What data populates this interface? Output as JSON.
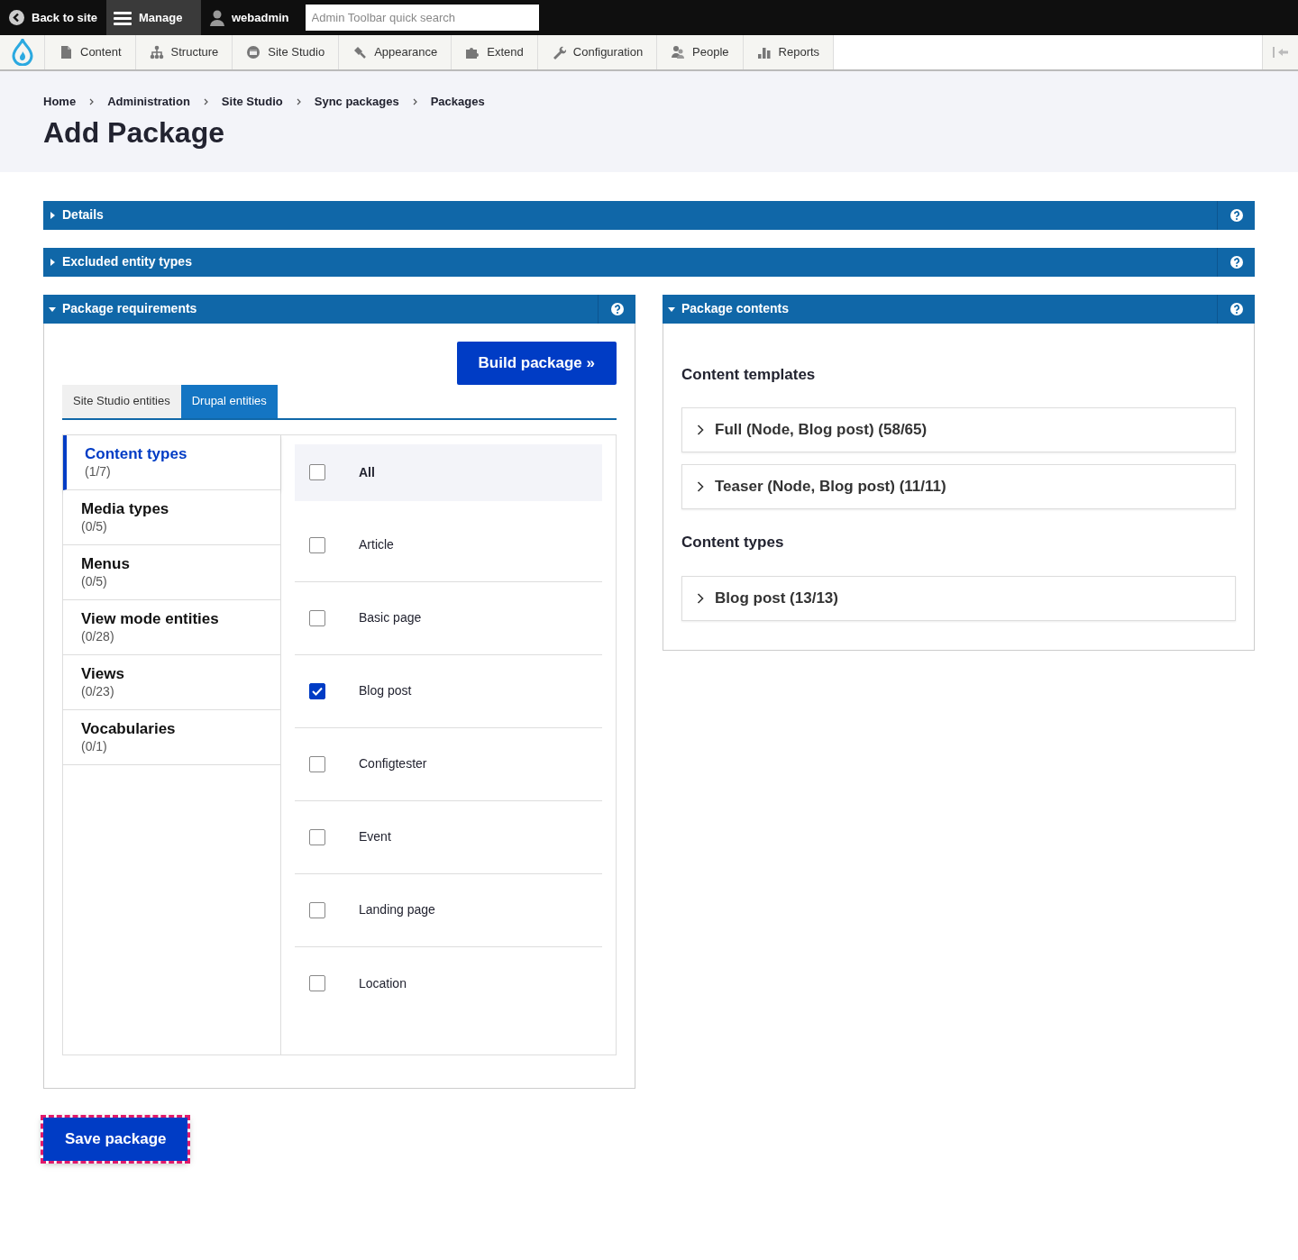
{
  "toolbar": {
    "back_link": "Back to site",
    "manage": {
      "label": "Manage",
      "selected": true
    },
    "user": "webadmin",
    "search": {
      "placeholder": "Admin Toolbar quick search"
    }
  },
  "menu": [
    {
      "label": "Content"
    },
    {
      "label": "Structure"
    },
    {
      "label": "Site Studio"
    },
    {
      "label": "Appearance"
    },
    {
      "label": "Extend"
    },
    {
      "label": "Configuration"
    },
    {
      "label": "People"
    },
    {
      "label": "Reports"
    }
  ],
  "breadcrumb": [
    "Home",
    "Administration",
    "Site Studio",
    "Sync packages",
    "Packages"
  ],
  "page_title": "Add Package",
  "sections": [
    {
      "title": "Details",
      "expanded": false
    },
    {
      "title": "Excluded entity types",
      "expanded": false
    }
  ],
  "requirements": {
    "title": "Package requirements",
    "expanded": true,
    "build_button": "Build package »",
    "tabs": [
      {
        "label": "Site Studio entities",
        "selected": false
      },
      {
        "label": "Drupal entities",
        "selected": true
      }
    ],
    "categories": [
      {
        "name": "Content types",
        "count": "(1/7)",
        "selected": true
      },
      {
        "name": "Media types",
        "count": "(0/5)",
        "selected": false
      },
      {
        "name": "Menus",
        "count": "(0/5)",
        "selected": false
      },
      {
        "name": "View mode entities",
        "count": "(0/28)",
        "selected": false
      },
      {
        "name": "Views",
        "count": "(0/23)",
        "selected": false
      },
      {
        "name": "Vocabularies",
        "count": "(0/1)",
        "selected": false
      }
    ],
    "items": [
      {
        "label": "All",
        "checked": false,
        "kind": "all"
      },
      {
        "label": "Article",
        "checked": false,
        "kind": "item"
      },
      {
        "label": "Basic page",
        "checked": false,
        "kind": "item"
      },
      {
        "label": "Blog post",
        "checked": true,
        "kind": "item"
      },
      {
        "label": "Configtester",
        "checked": false,
        "kind": "item"
      },
      {
        "label": "Event",
        "checked": false,
        "kind": "item"
      },
      {
        "label": "Landing page",
        "checked": false,
        "kind": "item"
      },
      {
        "label": "Location",
        "checked": false,
        "kind": "item"
      }
    ]
  },
  "contents": {
    "title": "Package contents",
    "expanded": true,
    "groups": [
      {
        "heading": "Content templates",
        "items": [
          "Full (Node, Blog post) (58/65)",
          "Teaser (Node, Blog post) (11/11)"
        ]
      },
      {
        "heading": "Content types",
        "items": [
          "Blog post (13/13)"
        ]
      }
    ]
  },
  "save_button": {
    "label": "Save package",
    "focused": true
  }
}
